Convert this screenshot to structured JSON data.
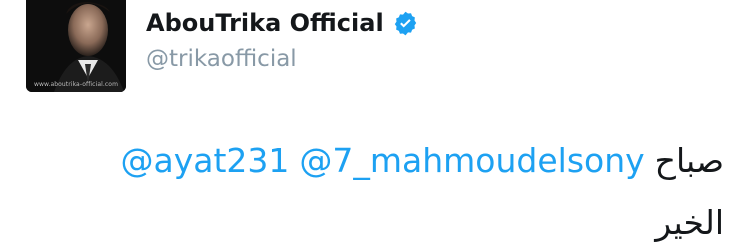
{
  "profile": {
    "display_name": "AbouTrika Official",
    "handle": "@trikaofficial",
    "avatar_caption": "www.aboutrika-official.com",
    "verified_icon": "verified-badge-icon",
    "verified_color": "#1da1f2"
  },
  "tweet": {
    "mentions": [
      "@ayat231",
      "@7_mahmoudelsony"
    ],
    "text_line1": "صباح",
    "text_line2": "الخير",
    "mention_color": "#1da1f2",
    "text_color": "#14171a"
  }
}
